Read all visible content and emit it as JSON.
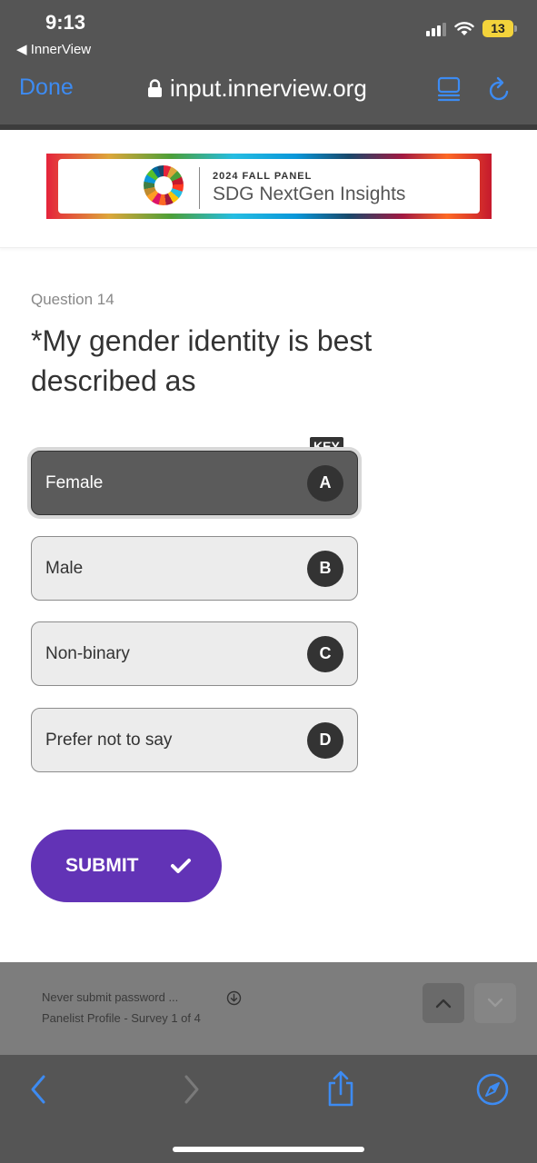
{
  "status_bar": {
    "time": "9:13",
    "back_app": "◀ InnerView",
    "battery": "13"
  },
  "browser": {
    "done_label": "Done",
    "url": "input.innerview.org"
  },
  "banner": {
    "small_text": "2024 FALL PANEL",
    "title": "SDG NextGen Insights"
  },
  "question": {
    "number": "Question 14",
    "text": "*My gender identity is best described as",
    "key_badge": "KEY",
    "options": [
      {
        "label": "Female",
        "letter": "A",
        "selected": true
      },
      {
        "label": "Male",
        "letter": "B",
        "selected": false
      },
      {
        "label": "Non-binary",
        "letter": "C",
        "selected": false
      },
      {
        "label": "Prefer not to say",
        "letter": "D",
        "selected": false
      }
    ],
    "submit_label": "SUBMIT"
  },
  "find_bar": {
    "line1": "Never submit password    ...",
    "line2": "Panelist Profile - Survey 1 of 4"
  },
  "colors": {
    "accent": "#6233b6",
    "ios_blue": "#3d8bf2",
    "chrome_gray": "#555555"
  },
  "icons": [
    "lock-icon",
    "reader-icon",
    "reload-icon",
    "checkmark-icon",
    "download-icon",
    "chevron-up-icon",
    "chevron-down-icon",
    "back-arrow-icon",
    "forward-arrow-icon",
    "share-icon",
    "compass-icon"
  ]
}
